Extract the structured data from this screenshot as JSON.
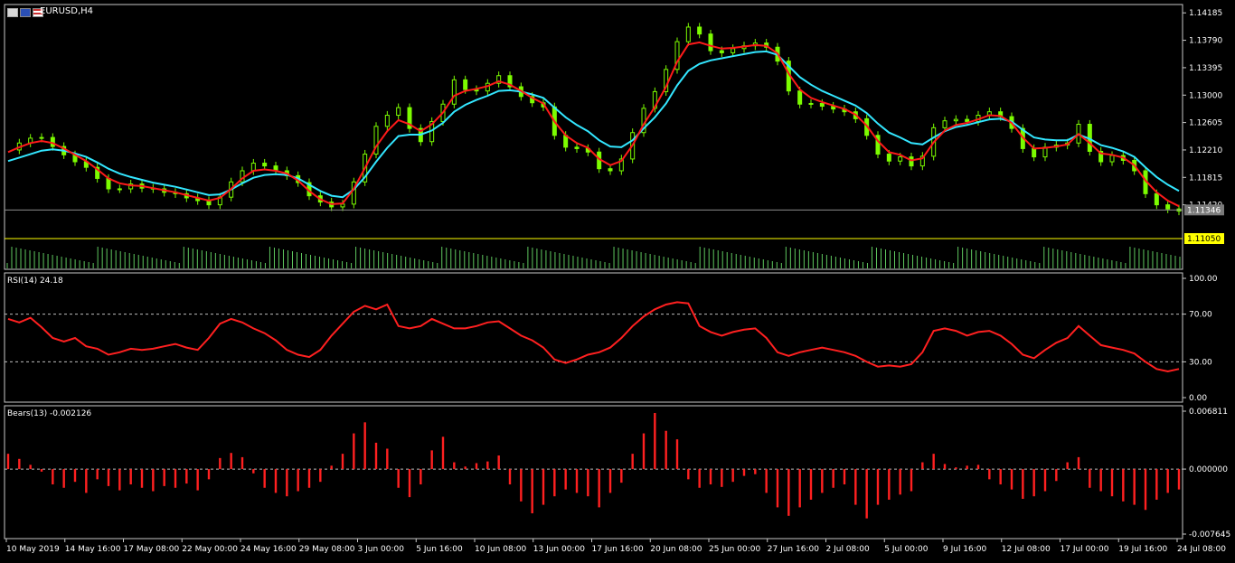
{
  "window_title": "EURUSD,H4",
  "colors": {
    "background": "#000000",
    "frame": "#c8c8c8",
    "bull_candle": "#7CFC00",
    "bear_candle": "#7CFC00",
    "ma_fast": "#ff1a1a",
    "ma_slow": "#33e6ff",
    "volume": "#5fc85f",
    "rsi": "#ff2020",
    "bears": "#ff2020",
    "bid_line": "#8c8c8c",
    "price_tag_yellow": "#ffff00"
  },
  "icons": [
    "window-menu-icon",
    "eu-flag-icon",
    "us-flag-icon"
  ],
  "chart_data": [
    {
      "type": "line",
      "panel": "price",
      "title": "EURUSD,H4",
      "y_ticks": [
        "1.14185",
        "1.13790",
        "1.13395",
        "1.13000",
        "1.12605",
        "1.12210",
        "1.11815",
        "1.11420"
      ],
      "ylim": [
        1.1122,
        1.1424
      ],
      "current_bid_label": "1.11346",
      "current_bid": 1.11346,
      "yellow_label": "1.11050",
      "yellow_level": 1.1105,
      "x_tick_labels": [
        "10 May 2019",
        "14 May 16:00",
        "17 May 08:00",
        "22 May 00:00",
        "24 May 16:00",
        "29 May 08:00",
        "3 Jun 00:00",
        "5 Jun 16:00",
        "10 Jun 08:00",
        "13 Jun 00:00",
        "17 Jun 16:00",
        "20 Jun 08:00",
        "25 Jun 00:00",
        "27 Jun 16:00",
        "2 Jul 08:00",
        "5 Jul 00:00",
        "9 Jul 16:00",
        "12 Jul 08:00",
        "17 Jul 00:00",
        "19 Jul 16:00",
        "24 Jul 08:00"
      ],
      "close_path": [
        1.1221,
        1.1231,
        1.1238,
        1.1239,
        1.1226,
        1.1214,
        1.1204,
        1.1196,
        1.118,
        1.1165,
        1.1165,
        1.1172,
        1.1166,
        1.1165,
        1.116,
        1.1158,
        1.1152,
        1.1148,
        1.1142,
        1.1153,
        1.1175,
        1.1191,
        1.1202,
        1.1198,
        1.1191,
        1.1184,
        1.1174,
        1.1155,
        1.1146,
        1.1139,
        1.1143,
        1.1175,
        1.1215,
        1.1255,
        1.1271,
        1.1282,
        1.1252,
        1.1233,
        1.1262,
        1.1287,
        1.1322,
        1.1308,
        1.1306,
        1.1317,
        1.1328,
        1.1312,
        1.1298,
        1.1289,
        1.1283,
        1.1242,
        1.1225,
        1.1223,
        1.1218,
        1.1194,
        1.1191,
        1.1208,
        1.1246,
        1.1281,
        1.1305,
        1.1337,
        1.1377,
        1.1398,
        1.1388,
        1.1364,
        1.1361,
        1.1367,
        1.1371,
        1.1375,
        1.1369,
        1.1349,
        1.1306,
        1.1287,
        1.1288,
        1.1284,
        1.128,
        1.1276,
        1.1266,
        1.1242,
        1.1215,
        1.1205,
        1.1211,
        1.1198,
        1.1212,
        1.1253,
        1.1263,
        1.1265,
        1.1262,
        1.1271,
        1.1276,
        1.1269,
        1.1252,
        1.1223,
        1.1211,
        1.1225,
        1.1228,
        1.1231,
        1.1258,
        1.1219,
        1.1204,
        1.1213,
        1.1206,
        1.1191,
        1.1158,
        1.1142,
        1.1136,
        1.1133
      ],
      "ma_fast_path": [
        1.1218,
        1.1225,
        1.1231,
        1.1234,
        1.1231,
        1.1223,
        1.1214,
        1.1205,
        1.1193,
        1.118,
        1.1173,
        1.117,
        1.1169,
        1.1166,
        1.1163,
        1.116,
        1.1156,
        1.1152,
        1.1148,
        1.1152,
        1.1165,
        1.118,
        1.1191,
        1.1193,
        1.1191,
        1.1187,
        1.1177,
        1.1162,
        1.115,
        1.1143,
        1.1144,
        1.1165,
        1.1195,
        1.1226,
        1.1248,
        1.1264,
        1.1258,
        1.1248,
        1.1258,
        1.1275,
        1.1299,
        1.1306,
        1.1309,
        1.1313,
        1.132,
        1.1315,
        1.1306,
        1.1296,
        1.1288,
        1.1262,
        1.1242,
        1.1231,
        1.1224,
        1.1208,
        1.1199,
        1.1205,
        1.1228,
        1.1258,
        1.1283,
        1.1312,
        1.1348,
        1.1373,
        1.1376,
        1.1371,
        1.1367,
        1.1368,
        1.137,
        1.1372,
        1.1371,
        1.136,
        1.1331,
        1.1308,
        1.1296,
        1.129,
        1.1285,
        1.128,
        1.1272,
        1.1256,
        1.1234,
        1.1218,
        1.1214,
        1.1206,
        1.1209,
        1.1232,
        1.1249,
        1.1257,
        1.126,
        1.1265,
        1.1271,
        1.127,
        1.126,
        1.1239,
        1.1223,
        1.1224,
        1.1226,
        1.1229,
        1.1244,
        1.1231,
        1.1216,
        1.1214,
        1.121,
        1.1199,
        1.1177,
        1.116,
        1.1148,
        1.114
      ],
      "ma_slow_path": [
        1.1205,
        1.121,
        1.1215,
        1.122,
        1.1222,
        1.122,
        1.1216,
        1.1211,
        1.1203,
        1.1194,
        1.1187,
        1.1182,
        1.1178,
        1.1174,
        1.1171,
        1.1168,
        1.1164,
        1.116,
        1.1156,
        1.1157,
        1.1164,
        1.1173,
        1.1181,
        1.1185,
        1.1186,
        1.1185,
        1.118,
        1.1171,
        1.1162,
        1.1155,
        1.1153,
        1.1164,
        1.1182,
        1.1204,
        1.1224,
        1.1241,
        1.1243,
        1.1243,
        1.1249,
        1.126,
        1.1276,
        1.1286,
        1.1293,
        1.1299,
        1.1306,
        1.1307,
        1.1305,
        1.1301,
        1.1296,
        1.1282,
        1.1268,
        1.1257,
        1.1248,
        1.1235,
        1.1226,
        1.1225,
        1.1235,
        1.1252,
        1.1268,
        1.1288,
        1.1314,
        1.1335,
        1.1345,
        1.135,
        1.1353,
        1.1356,
        1.1359,
        1.1362,
        1.1363,
        1.1358,
        1.1342,
        1.1326,
        1.1315,
        1.1306,
        1.1299,
        1.1292,
        1.1285,
        1.1274,
        1.1259,
        1.1246,
        1.1239,
        1.1231,
        1.1229,
        1.1239,
        1.1248,
        1.1254,
        1.1257,
        1.1261,
        1.1265,
        1.1266,
        1.1262,
        1.125,
        1.1239,
        1.1236,
        1.1235,
        1.1235,
        1.1243,
        1.1237,
        1.1228,
        1.1224,
        1.1219,
        1.1211,
        1.1196,
        1.1182,
        1.1171,
        1.1162
      ]
    },
    {
      "type": "line",
      "panel": "rsi",
      "title": "RSI(14) 24.18",
      "y_ticks": [
        "100.00",
        "70.00",
        "30.00",
        "0.00"
      ],
      "ylim": [
        0,
        100
      ],
      "levels": [
        70,
        30
      ],
      "values": [
        66,
        63,
        67,
        59,
        50,
        47,
        50,
        43,
        41,
        36,
        38,
        41,
        40,
        41,
        43,
        45,
        42,
        40,
        50,
        62,
        66,
        63,
        58,
        54,
        48,
        40,
        36,
        34,
        40,
        52,
        62,
        72,
        77,
        74,
        78,
        60,
        58,
        60,
        66,
        62,
        58,
        58,
        60,
        63,
        64,
        58,
        52,
        48,
        42,
        32,
        29,
        32,
        36,
        38,
        42,
        50,
        60,
        68,
        74,
        78,
        80,
        79,
        60,
        55,
        52,
        55,
        57,
        58,
        50,
        38,
        35,
        38,
        40,
        42,
        40,
        38,
        35,
        30,
        26,
        27,
        26,
        28,
        38,
        56,
        58,
        56,
        52,
        55,
        56,
        52,
        45,
        36,
        33,
        40,
        46,
        50,
        60,
        52,
        44,
        42,
        40,
        37,
        30,
        24,
        22,
        24
      ]
    },
    {
      "type": "bar",
      "panel": "bears",
      "title": "Bears(13) -0.002126",
      "y_ticks": [
        "0.006811",
        "0.000000",
        "-0.007645"
      ],
      "ylim": [
        -0.007645,
        0.006811
      ],
      "values": [
        0.0018,
        0.0012,
        0.0005,
        -0.0003,
        -0.0018,
        -0.0022,
        -0.0015,
        -0.0028,
        -0.0012,
        -0.002,
        -0.0025,
        -0.0018,
        -0.0022,
        -0.0026,
        -0.002,
        -0.0022,
        -0.0017,
        -0.0025,
        -0.0012,
        0.0013,
        0.0019,
        0.0014,
        -0.0005,
        -0.0022,
        -0.0028,
        -0.0032,
        -0.0026,
        -0.0022,
        -0.0015,
        0.0004,
        0.0018,
        0.0042,
        0.0055,
        0.0031,
        0.0024,
        -0.0022,
        -0.0033,
        -0.0018,
        0.0022,
        0.0038,
        0.0008,
        0.0003,
        0.0007,
        0.0009,
        0.0016,
        -0.0018,
        -0.0038,
        -0.0052,
        -0.0042,
        -0.0032,
        -0.0024,
        -0.0028,
        -0.0032,
        -0.0045,
        -0.0028,
        -0.0016,
        0.0018,
        0.0042,
        0.0066,
        0.0045,
        0.0035,
        -0.0012,
        -0.0022,
        -0.0018,
        -0.0021,
        -0.0015,
        -0.0008,
        -0.0006,
        -0.0028,
        -0.0045,
        -0.0055,
        -0.0045,
        -0.0036,
        -0.0028,
        -0.0022,
        -0.0018,
        -0.0042,
        -0.0058,
        -0.0042,
        -0.0036,
        -0.003,
        -0.0026,
        0.0008,
        0.0018,
        0.0006,
        0.0002,
        0.0004,
        0.0005,
        -0.0012,
        -0.0018,
        -0.0024,
        -0.0035,
        -0.0032,
        -0.0026,
        -0.0014,
        0.0008,
        0.0014,
        -0.0022,
        -0.0026,
        -0.0032,
        -0.0038,
        -0.0042,
        -0.0048,
        -0.0036,
        -0.0028,
        -0.0024
      ]
    }
  ]
}
